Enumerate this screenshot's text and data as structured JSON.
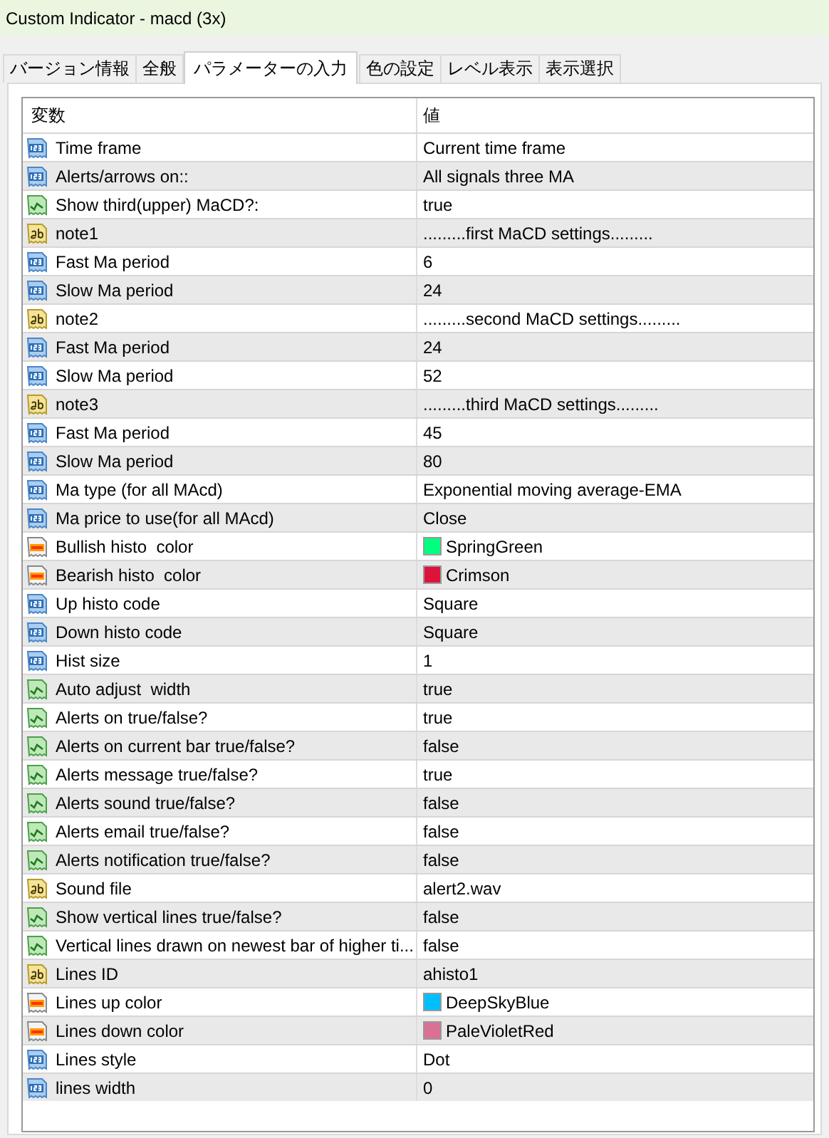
{
  "window": {
    "title": "Custom Indicator - macd (3x)"
  },
  "tabs": [
    {
      "label": "バージョン情報",
      "selected": false
    },
    {
      "label": "全般",
      "selected": false
    },
    {
      "label": "パラメーターの入力",
      "selected": true
    },
    {
      "label": "色の設定",
      "selected": false
    },
    {
      "label": "レベル表示",
      "selected": false
    },
    {
      "label": "表示選択",
      "selected": false
    }
  ],
  "table": {
    "columns": [
      "変数",
      "値"
    ],
    "rows": [
      {
        "kind": "number",
        "name": "Time frame",
        "value": "Current time frame"
      },
      {
        "kind": "number",
        "name": "Alerts/arrows on::",
        "value": "All signals three MA"
      },
      {
        "kind": "bool",
        "name": "Show third(upper) MaCD?:",
        "value": "true"
      },
      {
        "kind": "text",
        "name": "note1",
        "value": ".........first MaCD settings........."
      },
      {
        "kind": "number",
        "name": "Fast Ma period",
        "value": "6"
      },
      {
        "kind": "number",
        "name": "Slow Ma period",
        "value": "24"
      },
      {
        "kind": "text",
        "name": "note2",
        "value": ".........second MaCD settings........."
      },
      {
        "kind": "number",
        "name": "Fast Ma period",
        "value": "24"
      },
      {
        "kind": "number",
        "name": "Slow Ma period",
        "value": "52"
      },
      {
        "kind": "text",
        "name": "note3",
        "value": ".........third MaCD settings........."
      },
      {
        "kind": "number",
        "name": "Fast Ma period",
        "value": "45"
      },
      {
        "kind": "number",
        "name": "Slow Ma period",
        "value": "80"
      },
      {
        "kind": "number",
        "name": "Ma type (for all MAcd)",
        "value": "Exponential moving average-EMA"
      },
      {
        "kind": "number",
        "name": "Ma price to use(for all MAcd)",
        "value": "Close"
      },
      {
        "kind": "color",
        "name": "Bullish histo  color",
        "value": "SpringGreen",
        "color": "#00ff7f"
      },
      {
        "kind": "color",
        "name": "Bearish histo  color",
        "value": "Crimson",
        "color": "#dc143c"
      },
      {
        "kind": "number",
        "name": "Up histo code",
        "value": "Square"
      },
      {
        "kind": "number",
        "name": "Down histo code",
        "value": "Square"
      },
      {
        "kind": "number",
        "name": "Hist size",
        "value": "1"
      },
      {
        "kind": "bool",
        "name": "Auto adjust  width",
        "value": "true"
      },
      {
        "kind": "bool",
        "name": "Alerts on true/false?",
        "value": "true"
      },
      {
        "kind": "bool",
        "name": "Alerts on current bar true/false?",
        "value": "false"
      },
      {
        "kind": "bool",
        "name": "Alerts message true/false?",
        "value": "true"
      },
      {
        "kind": "bool",
        "name": "Alerts sound true/false?",
        "value": "false"
      },
      {
        "kind": "bool",
        "name": "Alerts email true/false?",
        "value": "false"
      },
      {
        "kind": "bool",
        "name": "Alerts notification true/false?",
        "value": "false"
      },
      {
        "kind": "text",
        "name": "Sound file",
        "value": "alert2.wav"
      },
      {
        "kind": "bool",
        "name": "Show vertical lines true/false?",
        "value": "false"
      },
      {
        "kind": "bool",
        "name": "Vertical lines drawn on newest bar of higher ti...",
        "value": "false"
      },
      {
        "kind": "text",
        "name": "Lines ID",
        "value": "ahisto1"
      },
      {
        "kind": "color",
        "name": "Lines up color",
        "value": "DeepSkyBlue",
        "color": "#00bfff"
      },
      {
        "kind": "color",
        "name": "Lines down color",
        "value": "PaleVioletRed",
        "color": "#db7093"
      },
      {
        "kind": "number",
        "name": "Lines style",
        "value": "Dot"
      },
      {
        "kind": "number",
        "name": "lines width",
        "value": "0"
      }
    ]
  }
}
